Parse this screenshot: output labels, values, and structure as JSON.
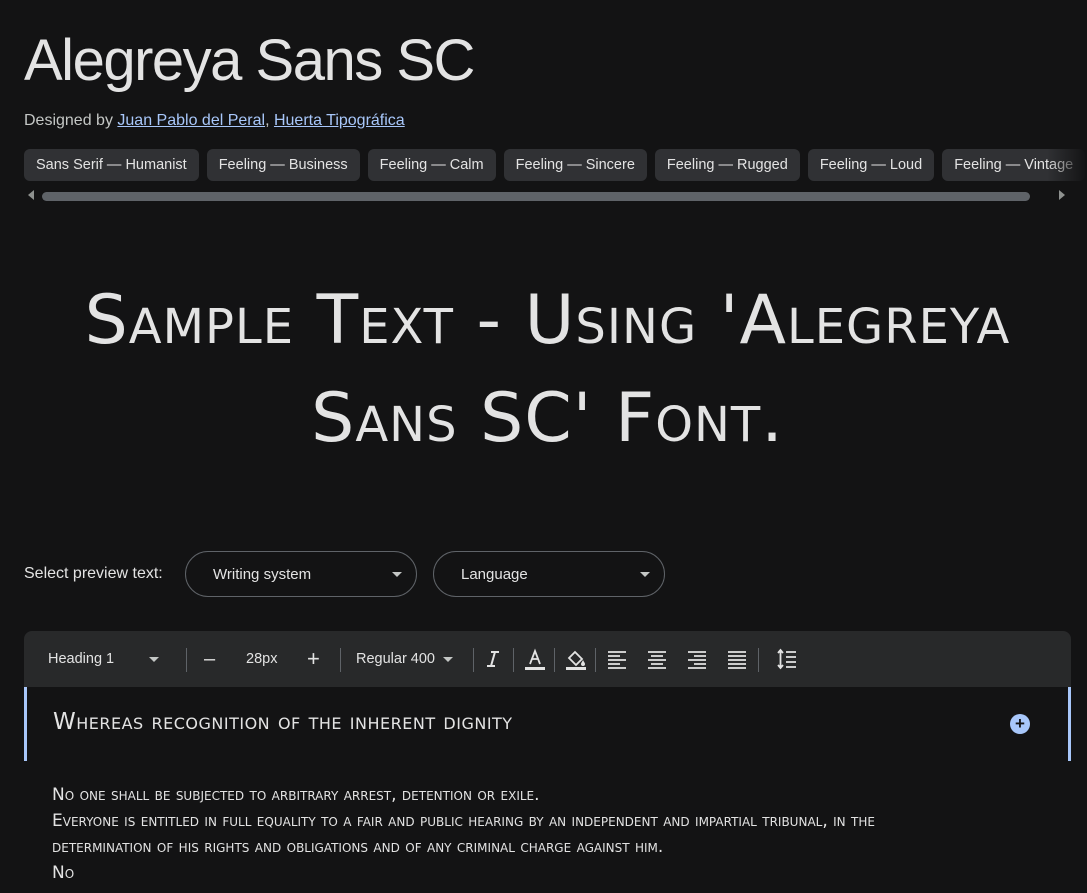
{
  "font": {
    "title": "Alegreya Sans SC",
    "designed_by_label": "Designed by",
    "designers": [
      "Juan Pablo del Peral",
      "Huerta Tipográfica"
    ],
    "designer_separator": ","
  },
  "tags": [
    "Sans Serif — Humanist",
    "Feeling — Business",
    "Feeling — Calm",
    "Feeling — Sincere",
    "Feeling — Rugged",
    "Feeling — Loud",
    "Feeling — Vintage"
  ],
  "sample": {
    "text": "Sample Text - Using 'Alegreya Sans SC' Font."
  },
  "preview": {
    "label": "Select preview text:",
    "writing_system": "Writing system",
    "language": "Language"
  },
  "toolbar": {
    "style": "Heading 1",
    "decrease": "–",
    "size": "28px",
    "increase": "+",
    "weight": "Regular 400"
  },
  "editor": {
    "heading": "Whereas recognition of the inherent dignity",
    "lines": [
      "No one shall be subjected to arbitrary arrest, detention or exile.",
      "Everyone is entitled in full equality to a fair and public hearing by an independent and impartial tribunal, in the determination of his rights and obligations and of any criminal charge against him.",
      "No"
    ]
  },
  "colors": {
    "background": "#131314",
    "accent": "#a8c7fa",
    "chip": "#303134",
    "toolbar": "#28292a"
  }
}
